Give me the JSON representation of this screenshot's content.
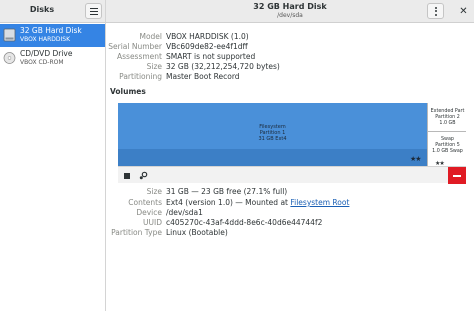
{
  "sidebar": {
    "title": "Disks",
    "drives": [
      {
        "name": "32 GB Hard Disk",
        "subtitle": "VBOX HARDDISK",
        "icon": "harddisk-icon",
        "selected": true
      },
      {
        "name": "CD/DVD Drive",
        "subtitle": "VBOX CD-ROM",
        "icon": "optical-disc-icon",
        "selected": false
      }
    ]
  },
  "header": {
    "title": "32 GB Hard Disk",
    "subtitle": "/dev/sda"
  },
  "disk": {
    "rows": [
      {
        "label": "Model",
        "value": "VBOX HARDDISK (1.0)"
      },
      {
        "label": "Serial Number",
        "value": "VBc609de82-ee4f1dff"
      },
      {
        "label": "Assessment",
        "value": "SMART is not supported"
      },
      {
        "label": "Size",
        "value": "32 GB (32,212,254,720 bytes)"
      },
      {
        "label": "Partitioning",
        "value": "Master Boot Record"
      }
    ]
  },
  "volumes": {
    "heading": "Volumes",
    "partition1": {
      "line1": "Filesystem",
      "line2": "Partition 1",
      "line3": "31 GB Ext4",
      "stars": "★★"
    },
    "extended": {
      "line1": "Extended Part",
      "line2": "Partition 2",
      "line3": "1.0 GB"
    },
    "swap": {
      "line1": "Swap",
      "line2": "Partition 5",
      "line3": "1.0 GB Swap",
      "stars": "★★"
    }
  },
  "selected_volume": {
    "size_label": "Size",
    "size_value": "31 GB — 23 GB free (27.1% full)",
    "contents_label": "Contents",
    "contents_prefix": "Ext4 (version 1.0) — Mounted at ",
    "contents_link": "Filesystem Root",
    "device_label": "Device",
    "device_value": "/dev/sda1",
    "uuid_label": "UUID",
    "uuid_value": "c405270c-43af-4ddd-8e6c-40d6e44744f2",
    "ptype_label": "Partition Type",
    "ptype_value": "Linux (Bootable)"
  },
  "colors": {
    "accent": "#3584e4",
    "partition_fill": "#4a90d9",
    "delete": "#e01b24"
  }
}
